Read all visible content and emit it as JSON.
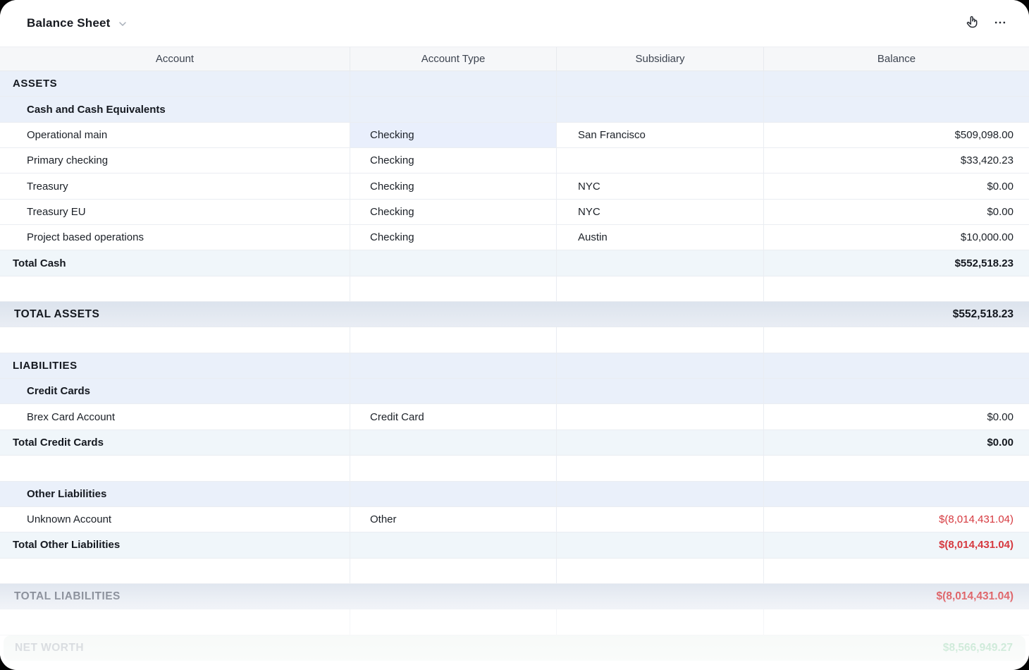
{
  "window": {
    "title": "Balance Sheet"
  },
  "toolbar": {
    "hand_icon": "hand-pointer",
    "more_icon": "ellipsis-horizontal",
    "title_chevron_icon": "chevron-down"
  },
  "colors": {
    "negative": "#d6393f",
    "positive": "#7ec89b",
    "section_row": "#eaf0fa",
    "total_row": "#f0f6fa",
    "grand_row": "#dce3ed",
    "highlight_cell": "#e9effc"
  },
  "table": {
    "columns": [
      "Account",
      "Account Type",
      "Subsidiary",
      "Balance"
    ],
    "rows": [
      {
        "type": "section",
        "account": "ASSETS"
      },
      {
        "type": "subsection",
        "account": "Cash and Cash Equivalents"
      },
      {
        "type": "account",
        "account": "Operational main",
        "account_type": "Checking",
        "subsidiary": "San Francisco",
        "balance": "$509,098.00",
        "highlight_type_cell": true
      },
      {
        "type": "account",
        "account": "Primary checking",
        "account_type": "Checking",
        "subsidiary": "",
        "balance": "$33,420.23"
      },
      {
        "type": "account",
        "account": "Treasury",
        "account_type": "Checking",
        "subsidiary": "NYC",
        "balance": "$0.00"
      },
      {
        "type": "account",
        "account": "Treasury EU",
        "account_type": "Checking",
        "subsidiary": "NYC",
        "balance": "$0.00"
      },
      {
        "type": "account",
        "account": "Project based operations",
        "account_type": "Checking",
        "subsidiary": "Austin",
        "balance": "$10,000.00"
      },
      {
        "type": "total",
        "account": "Total Cash",
        "balance": "$552,518.23"
      },
      {
        "type": "empty"
      },
      {
        "type": "grandtotal",
        "account": "TOTAL ASSETS",
        "balance": "$552,518.23"
      },
      {
        "type": "empty"
      },
      {
        "type": "section",
        "account": "LIABILITIES"
      },
      {
        "type": "subsection",
        "account": "Credit Cards"
      },
      {
        "type": "account",
        "account": "Brex Card Account",
        "account_type": "Credit Card",
        "subsidiary": "",
        "balance": "$0.00"
      },
      {
        "type": "total",
        "account": "Total Credit Cards",
        "balance": "$0.00"
      },
      {
        "type": "empty"
      },
      {
        "type": "subsection",
        "account": "Other Liabilities"
      },
      {
        "type": "account",
        "account": "Unknown Account",
        "account_type": "Other",
        "subsidiary": "",
        "balance": "$(8,014,431.04)",
        "negative": true
      },
      {
        "type": "total",
        "account": "Total Other Liabilities",
        "balance": "$(8,014,431.04)",
        "negative": true
      },
      {
        "type": "empty"
      },
      {
        "type": "grandtotal",
        "account": "TOTAL LIABILITIES",
        "balance": "$(8,014,431.04)",
        "negative": true,
        "faded": true
      },
      {
        "type": "empty"
      },
      {
        "type": "networth",
        "account": "NET WORTH",
        "balance": "$8,566,949.27",
        "positive": true
      }
    ]
  }
}
